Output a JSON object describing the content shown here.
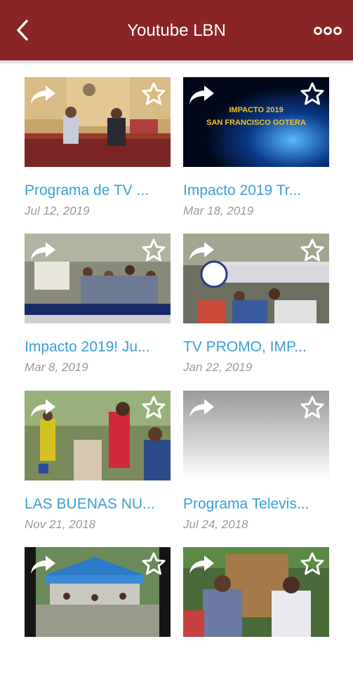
{
  "header": {
    "title": "Youtube LBN",
    "back_icon": "chevron-left-icon",
    "menu_icon": "more-horizontal-icon",
    "bar_color": "#8b2525"
  },
  "videos": [
    {
      "title": "Programa de TV ...",
      "date": "Jul 12, 2019"
    },
    {
      "title": "Impacto 2019 Tr...",
      "date": "Mar 18, 2019",
      "thumb_text": [
        "IMPACTO 2019",
        "SAN FRANCISCO GOTERA"
      ]
    },
    {
      "title": "Impacto 2019! Ju...",
      "date": "Mar 8, 2019"
    },
    {
      "title": "TV PROMO, IMP...",
      "date": "Jan 22, 2019"
    },
    {
      "title": "LAS BUENAS NU...",
      "date": "Nov 21, 2018"
    },
    {
      "title": "Programa Televis...",
      "date": "Jul 24, 2018"
    },
    {
      "title": "",
      "date": ""
    },
    {
      "title": "",
      "date": ""
    }
  ],
  "colors": {
    "title_link": "#3a9fd6",
    "date": "#9a9a9a"
  }
}
